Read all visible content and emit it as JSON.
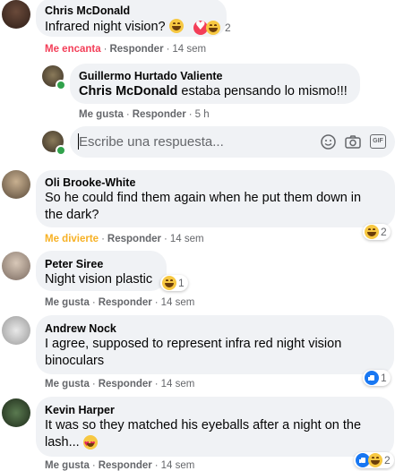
{
  "comments": [
    {
      "name": "Chris McDonald",
      "lines": [
        "Infrared night vision? "
      ],
      "reaction_count": "2",
      "actions": {
        "reaction": "Me encanta",
        "reply": "Responder",
        "time": "14 sem"
      }
    },
    {
      "name": "Guillermo Hurtado Valiente",
      "mention": "Chris McDonald",
      "lines": [
        " estaba pensando lo mismo!!!"
      ],
      "actions": {
        "like": "Me gusta",
        "reply": "Responder",
        "time": "5 h"
      }
    },
    {
      "name": "Oli Brooke-White",
      "lines": [
        "So he could find them again when he put them down in",
        "the dark?"
      ],
      "reaction_count": "2",
      "actions": {
        "reaction": "Me divierte",
        "reply": "Responder",
        "time": "14 sem"
      }
    },
    {
      "name": "Peter Siree",
      "lines": [
        "Night vision plastic"
      ],
      "reaction_count": "1",
      "actions": {
        "like": "Me gusta",
        "reply": "Responder",
        "time": "14 sem"
      }
    },
    {
      "name": "Andrew Nock",
      "lines": [
        "I agree, supposed to represent infra red night vision",
        "binoculars"
      ],
      "reaction_count": "1",
      "actions": {
        "like": "Me gusta",
        "reply": "Responder",
        "time": "14 sem"
      }
    },
    {
      "name": "Kevin Harper",
      "lines": [
        "It was so they matched his eyeballs after a night on the",
        "lash..."
      ],
      "reaction_count": "2",
      "actions": {
        "like": "Me gusta",
        "reply": "Responder",
        "time": "14 sem"
      }
    }
  ],
  "reply_box": {
    "placeholder": "Escribe una respuesta...",
    "gif_label": "GIF"
  },
  "colors": {
    "bubble": "#f0f2f5",
    "meta": "#65676b",
    "love": "#f33e58",
    "haha": "#f7b125",
    "like": "#1877f2"
  }
}
